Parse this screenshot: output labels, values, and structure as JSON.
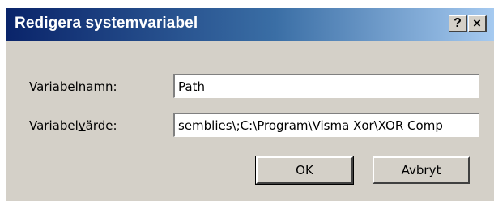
{
  "window": {
    "title": "Redigera systemvariabel",
    "help_button": "?",
    "close_button": "×"
  },
  "form": {
    "name_label_pre": "Variabel",
    "name_label_accel": "n",
    "name_label_post": "amn:",
    "name_value": "Path",
    "value_label_pre": "Variabel",
    "value_label_accel": "v",
    "value_label_post": "ärde:",
    "value_value": "semblies\\;C:\\Program\\Visma Xor\\XOR Comp"
  },
  "buttons": {
    "ok": "OK",
    "cancel": "Avbryt"
  },
  "colors": {
    "dialog_face": "#d4d0c8",
    "title_start": "#0a246a",
    "title_end": "#a6caf0"
  }
}
